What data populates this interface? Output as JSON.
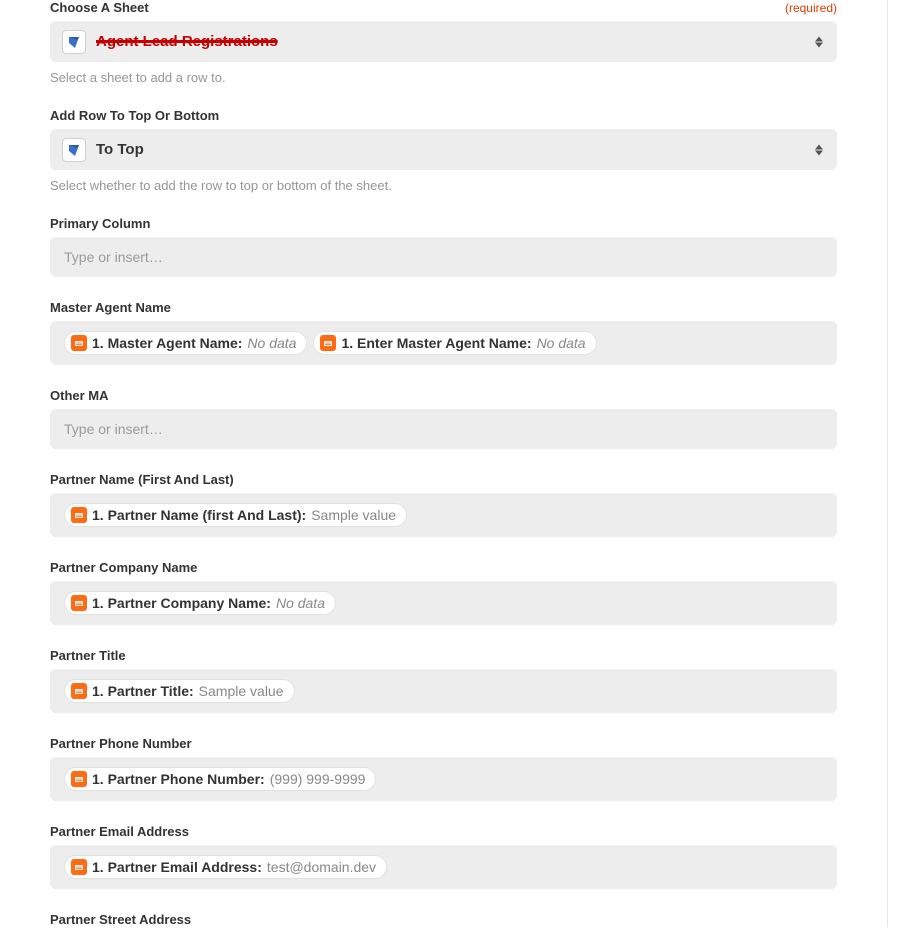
{
  "chooseSheet": {
    "label": "Choose A Sheet",
    "required": "(required)",
    "value": "Agent Lead Registrations",
    "helper": "Select a sheet to add a row to."
  },
  "addRow": {
    "label": "Add Row To Top Or Bottom",
    "value": "To Top",
    "helper": "Select whether to add the row to top or bottom of the sheet."
  },
  "primaryColumn": {
    "label": "Primary Column",
    "placeholder": "Type or insert…"
  },
  "masterAgent": {
    "label": "Master Agent Name",
    "pills": [
      {
        "label": "1. Master Agent Name:",
        "value": "No data",
        "italic": true
      },
      {
        "label": "1. Enter Master Agent Name:",
        "value": "No data",
        "italic": true
      }
    ]
  },
  "otherMA": {
    "label": "Other MA",
    "placeholder": "Type or insert…"
  },
  "partnerName": {
    "label": "Partner Name (First And Last)",
    "pills": [
      {
        "label": "1. Partner Name (first And Last):",
        "value": "Sample value",
        "italic": false
      }
    ]
  },
  "partnerCompany": {
    "label": "Partner Company Name",
    "pills": [
      {
        "label": "1. Partner Company Name:",
        "value": "No data",
        "italic": true
      }
    ]
  },
  "partnerTitle": {
    "label": "Partner Title",
    "pills": [
      {
        "label": "1. Partner Title:",
        "value": "Sample value",
        "italic": false
      }
    ]
  },
  "partnerPhone": {
    "label": "Partner Phone Number",
    "pills": [
      {
        "label": "1. Partner Phone Number:",
        "value": "(999) 999-9999",
        "italic": false
      }
    ]
  },
  "partnerEmail": {
    "label": "Partner Email Address",
    "pills": [
      {
        "label": "1. Partner Email Address:",
        "value": "test@domain.dev",
        "italic": false
      }
    ]
  },
  "partnerStreet": {
    "label": "Partner Street Address"
  }
}
